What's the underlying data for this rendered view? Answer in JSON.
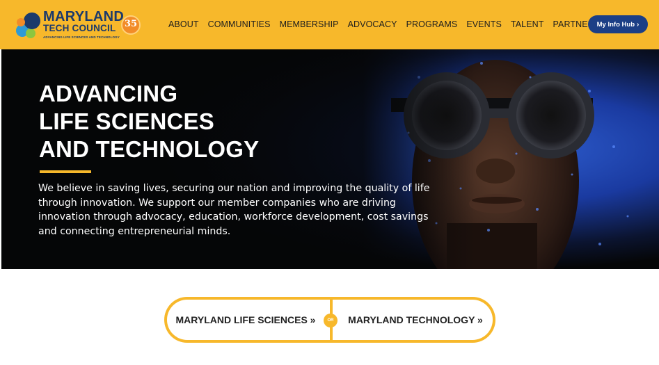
{
  "brand": {
    "name_line1": "MARYLAND",
    "name_line2": "TECH COUNCIL",
    "tagline": "ADVANCING LIFE SCIENCES AND TECHNOLOGY",
    "anniversary": "35",
    "colors": {
      "accent": "#f7b82b",
      "navy": "#1c3a6b",
      "button": "#1c3f86"
    }
  },
  "nav": {
    "items": [
      "ABOUT",
      "COMMUNITIES",
      "MEMBERSHIP",
      "ADVOCACY",
      "PROGRAMS",
      "EVENTS",
      "TALENT",
      "PARTNERS"
    ],
    "hub_button": "My Info Hub",
    "hub_icon": "chevron-right-icon"
  },
  "hero": {
    "headline": [
      "ADVANCING",
      "LIFE SCIENCES",
      "AND TECHNOLOGY"
    ],
    "description": "We believe in saving lives, securing our nation and improving the quality of life through innovation. We support our member companies who are driving innovation through advocacy, education, workforce development, cost savings and connecting entrepreneurial minds."
  },
  "cta": {
    "left_label": "MARYLAND LIFE SCIENCES »",
    "separator": "OR",
    "right_label": "MARYLAND TECHNOLOGY »"
  }
}
